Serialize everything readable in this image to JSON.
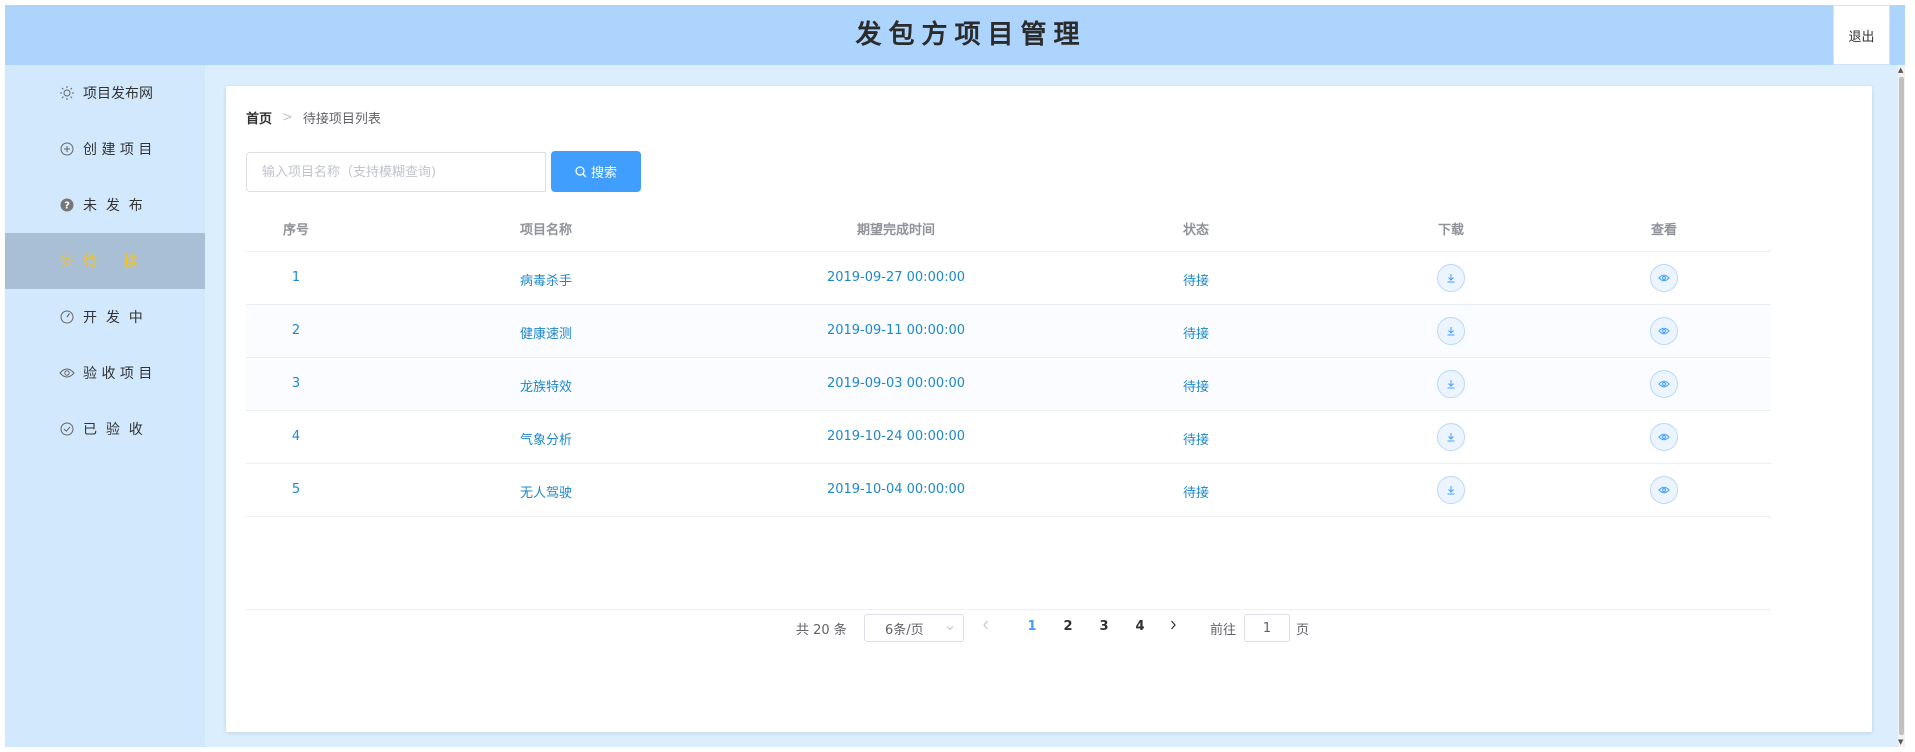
{
  "header": {
    "title": "发包方项目管理",
    "logout_label": "退出"
  },
  "sidebar": {
    "items": [
      {
        "label": "项目发布网",
        "icon": "sun-icon",
        "active": false
      },
      {
        "label": "创 建 项 目",
        "icon": "plus-circle-icon",
        "active": false
      },
      {
        "label": "未  发  布",
        "icon": "question-circle-icon",
        "active": false
      },
      {
        "label": "待      接",
        "icon": "sun-icon",
        "active": true
      },
      {
        "label": "开  发  中",
        "icon": "compass-icon",
        "active": false
      },
      {
        "label": "验 收 项 目",
        "icon": "eye-icon",
        "active": false
      },
      {
        "label": "已  验  收",
        "icon": "check-circle-icon",
        "active": false
      }
    ]
  },
  "breadcrumb": {
    "home": "首页",
    "separator": ">",
    "current": "待接项目列表"
  },
  "search": {
    "placeholder": "输入项目名称（支持模糊查询)",
    "value": "",
    "button_label": "搜索"
  },
  "table": {
    "columns": [
      "序号",
      "项目名称",
      "期望完成时间",
      "状态",
      "下载",
      "查看"
    ],
    "rows": [
      {
        "index": "1",
        "name": "病毒杀手",
        "deadline": "2019-09-27 00:00:00",
        "status": "待接"
      },
      {
        "index": "2",
        "name": "健康速测",
        "deadline": "2019-09-11 00:00:00",
        "status": "待接"
      },
      {
        "index": "3",
        "name": "龙族特效",
        "deadline": "2019-09-03 00:00:00",
        "status": "待接"
      },
      {
        "index": "4",
        "name": "气象分析",
        "deadline": "2019-10-24 00:00:00",
        "status": "待接"
      },
      {
        "index": "5",
        "name": "无人驾驶",
        "deadline": "2019-10-04 00:00:00",
        "status": "待接"
      }
    ]
  },
  "pagination": {
    "total_label": "共 20 条",
    "page_size": "6条/页",
    "pages": [
      "1",
      "2",
      "3",
      "4"
    ],
    "current_page": "1",
    "goto_label": "前往",
    "goto_value": "1",
    "page_suffix": "页"
  },
  "colors": {
    "header_bg": "#acd4fc",
    "sidebar_bg": "#d2e8fd",
    "active_bg": "#a9bfd6",
    "active_text": "#f7c21c",
    "link": "#1e88c8",
    "primary": "#409eff"
  }
}
